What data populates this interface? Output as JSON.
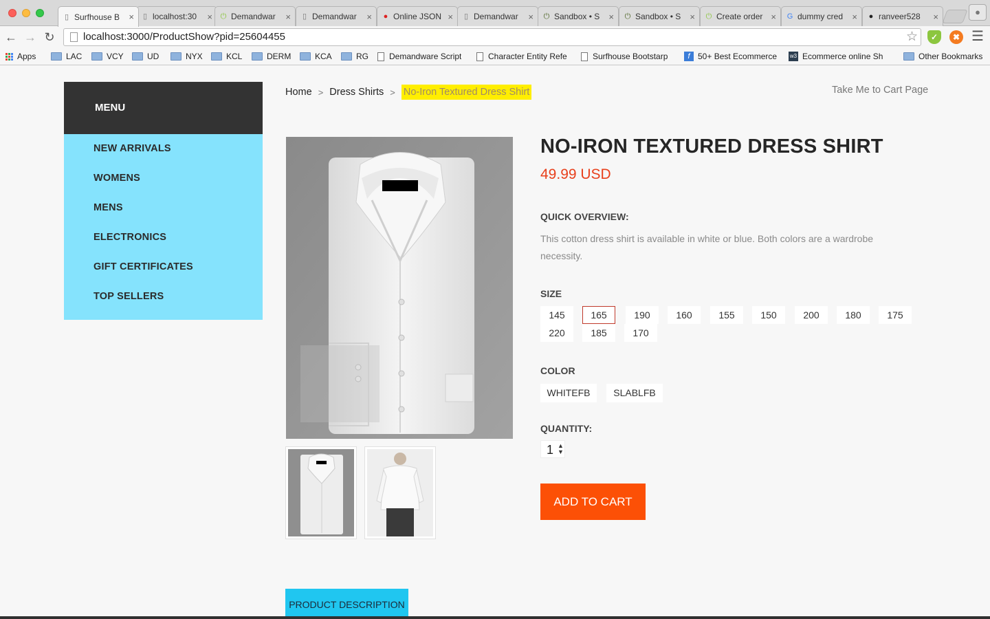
{
  "browser": {
    "tabs": [
      {
        "title": "Surfhouse B",
        "favicon": "page-icon",
        "active": true
      },
      {
        "title": "localhost:30",
        "favicon": "page-icon"
      },
      {
        "title": "Demandwar",
        "favicon": "power-icon"
      },
      {
        "title": "Demandwar",
        "favicon": "page-icon"
      },
      {
        "title": "Online JSON",
        "favicon": "opera-icon"
      },
      {
        "title": "Demandwar",
        "favicon": "page-icon"
      },
      {
        "title": "Sandbox • S",
        "favicon": "sandbox-icon"
      },
      {
        "title": "Sandbox • S",
        "favicon": "sandbox-icon"
      },
      {
        "title": "Create order",
        "favicon": "power-icon"
      },
      {
        "title": "dummy cred",
        "favicon": "google-icon"
      },
      {
        "title": "ranveer528",
        "favicon": "github-icon"
      }
    ],
    "url": "localhost:3000/ProductShow?pid=25604455",
    "bookmarks": [
      {
        "label": "Apps",
        "icon": "apps-icon"
      },
      {
        "label": "LAC",
        "icon": "folder-icon"
      },
      {
        "label": "VCY",
        "icon": "folder-icon"
      },
      {
        "label": "UD",
        "icon": "folder-icon"
      },
      {
        "label": "NYX",
        "icon": "folder-icon"
      },
      {
        "label": "KCL",
        "icon": "folder-icon"
      },
      {
        "label": "DERM",
        "icon": "folder-icon"
      },
      {
        "label": "KCA",
        "icon": "folder-icon"
      },
      {
        "label": "RG",
        "icon": "folder-icon"
      },
      {
        "label": "Demandware Script",
        "icon": "page-icon"
      },
      {
        "label": "Character Entity Refe",
        "icon": "page-icon"
      },
      {
        "label": "Surfhouse Bootstarp",
        "icon": "page-icon"
      },
      {
        "label": "50+ Best Ecommerce",
        "icon": "f-icon"
      },
      {
        "label": "Ecommerce online Sh",
        "icon": "w3-icon"
      },
      {
        "label": "Other Bookmarks",
        "icon": "folder-icon"
      }
    ]
  },
  "menu": {
    "title": "MENU",
    "items": [
      "NEW ARRIVALS",
      "WOMENS",
      "MENS",
      "ELECTRONICS",
      "GIFT CERTIFICATES",
      "TOP SELLERS"
    ]
  },
  "breadcrumb": {
    "items": [
      "Home",
      "Dress Shirts"
    ],
    "separator": ">",
    "current": "No-Iron Textured Dress Shirt"
  },
  "cart_link": "Take Me to Cart Page",
  "product": {
    "title": "NO-IRON TEXTURED DRESS SHIRT",
    "price": "49.99 USD",
    "overview_label": "QUICK OVERVIEW:",
    "overview_text": "This cotton dress shirt is available in white or blue. Both colors are a wardrobe necessity.",
    "size_label": "SIZE",
    "sizes": [
      "145",
      "165",
      "190",
      "160",
      "155",
      "150",
      "200",
      "180",
      "175",
      "220",
      "185",
      "170"
    ],
    "selected_size": "165",
    "color_label": "COLOR",
    "colors": [
      "WHITEFB",
      "SLABLFB"
    ],
    "quantity_label": "QUANTITY:",
    "quantity": "1",
    "add_to_cart": "ADD TO CART",
    "description_tab": "PRODUCT DESCRIPTION"
  },
  "colors": {
    "menu_bg": "#85e3fd",
    "menu_header": "#333333",
    "price": "#e8401c",
    "add_to_cart": "#fc5006",
    "breadcrumb_highlight": "#ffee00",
    "description_tab": "#20c6f0"
  }
}
